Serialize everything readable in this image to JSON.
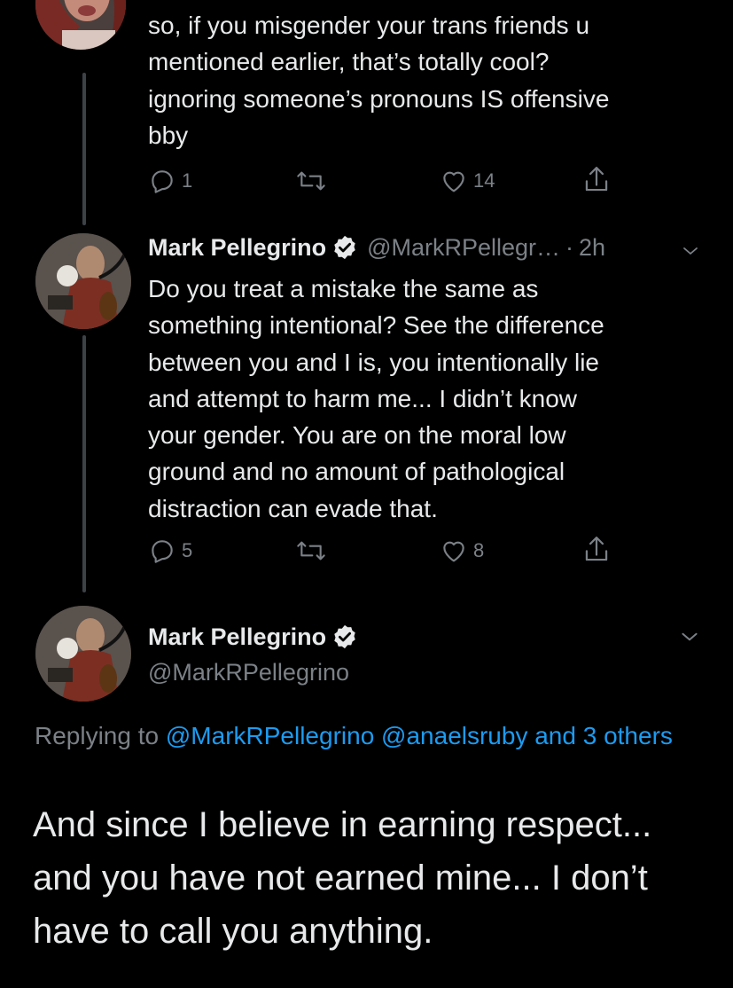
{
  "tweet1": {
    "text": "so, if you misgender your trans friends u\nmentioned earlier, that’s totally cool?\nignoring someone’s pronouns IS offensive\nbby",
    "replies": "1",
    "likes": "14"
  },
  "tweet2": {
    "name": "Mark Pellegrino",
    "handle": "@MarkRPellegr…",
    "separator": "·",
    "time": "2h",
    "text": "Do you treat a mistake the same as\nsomething intentional? See the difference\nbetween you and I is, you intentionally lie\nand attempt to harm me... I didn’t know\nyour gender. You are on the moral low\nground and no amount of pathological\ndistraction can evade that.",
    "replies": "5",
    "likes": "8"
  },
  "main_tweet": {
    "name": "Mark Pellegrino",
    "handle": "@MarkRPellegrino",
    "replying_prefix": "Replying to",
    "mention1": "@MarkRPellegrino",
    "mention2": "@anaelsruby",
    "others_text": "and 3 others",
    "text": "And since I believe in earning respect...\nand you have not earned mine... I don’t\nhave to call you anything."
  },
  "colors": {
    "background": "#000000",
    "text": "#e7e9ea",
    "muted": "#7b8187",
    "link": "#1d9bf0",
    "verified": "#e7e9ea"
  },
  "icons": [
    "reply-icon",
    "retweet-icon",
    "like-icon",
    "share-icon",
    "verified-icon",
    "chevron-down-icon"
  ]
}
